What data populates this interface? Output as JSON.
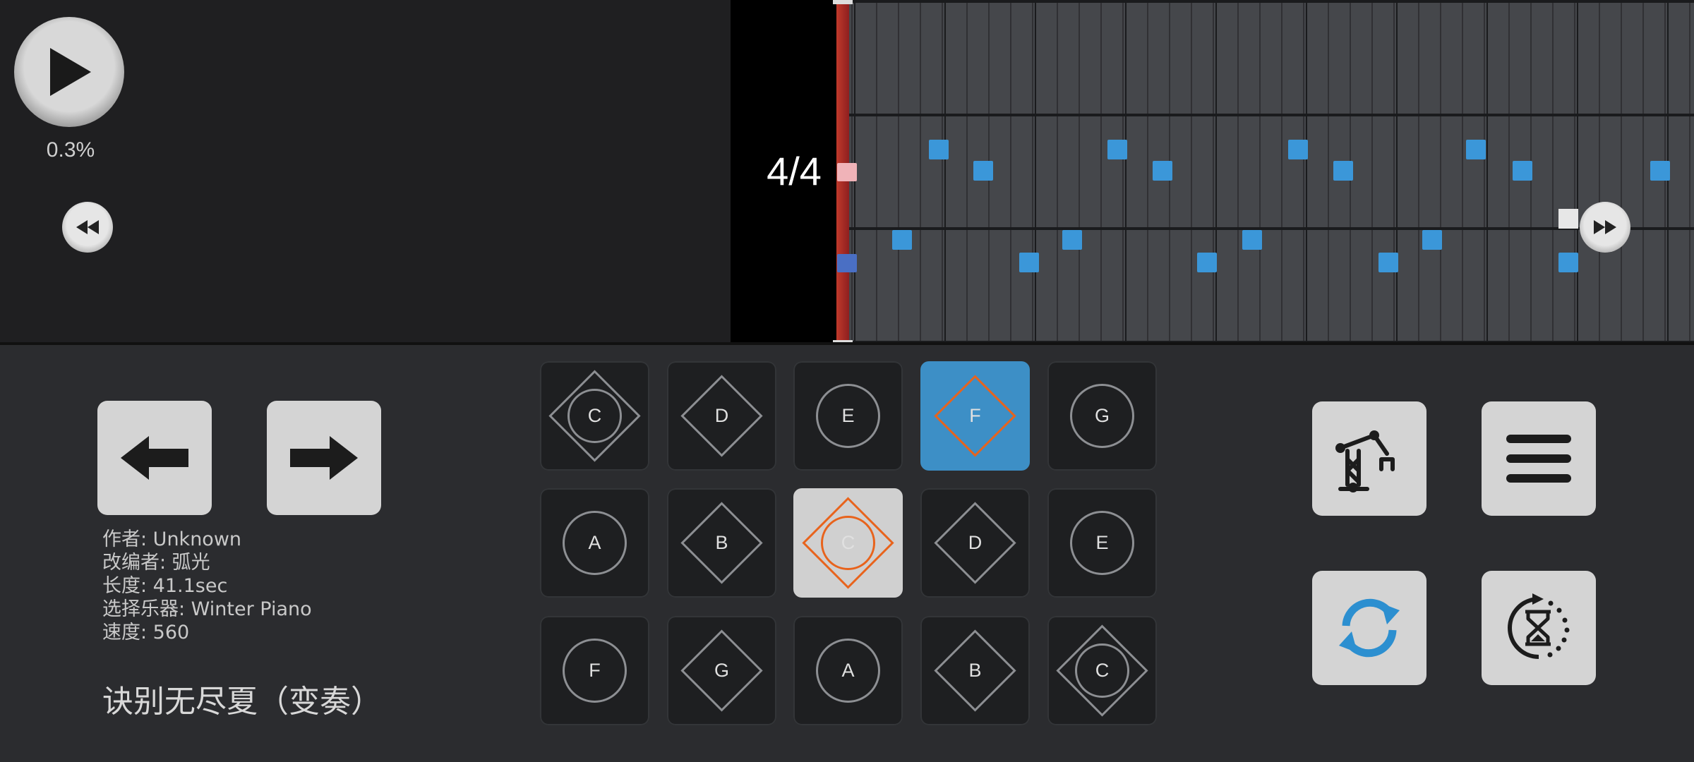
{
  "player": {
    "progress_text": "0.3%",
    "time_signature": "4/4"
  },
  "icons": {
    "play": "play-icon",
    "rewind": "rewind-icon",
    "fast_forward": "fast-forward-icon",
    "prev": "arrow-left-icon",
    "next": "arrow-right-icon",
    "robot": "robot-arm-icon",
    "menu": "hamburger-menu-icon",
    "sync": "sync-icon",
    "timer": "hourglass-timer-icon"
  },
  "colors": {
    "note": "#3b97d9",
    "active_key": "#3d8fc6",
    "highlight_shape": "#e8631c",
    "playhead": "#c0392b"
  },
  "song_info": {
    "author": "作者: Unknown",
    "arranger": "改编者: 弧光",
    "length": "长度: 41.1sec",
    "instrument": "选择乐器: Winter Piano",
    "speed": "速度: 560",
    "title": "诀别无尽夏（变奏）"
  },
  "keys": [
    {
      "label": "C",
      "shape": "circle-diamond",
      "state": "normal"
    },
    {
      "label": "D",
      "shape": "diamond",
      "state": "normal"
    },
    {
      "label": "E",
      "shape": "circle",
      "state": "normal"
    },
    {
      "label": "F",
      "shape": "diamond",
      "state": "active-blue"
    },
    {
      "label": "G",
      "shape": "circle",
      "state": "normal"
    },
    {
      "label": "A",
      "shape": "circle",
      "state": "normal"
    },
    {
      "label": "B",
      "shape": "diamond",
      "state": "normal"
    },
    {
      "label": "C",
      "shape": "circle-diamond",
      "state": "active-gray"
    },
    {
      "label": "D",
      "shape": "diamond",
      "state": "normal"
    },
    {
      "label": "E",
      "shape": "circle",
      "state": "normal"
    },
    {
      "label": "F",
      "shape": "circle",
      "state": "normal"
    },
    {
      "label": "G",
      "shape": "diamond",
      "state": "normal"
    },
    {
      "label": "A",
      "shape": "circle",
      "state": "normal"
    },
    {
      "label": "B",
      "shape": "diamond",
      "state": "normal"
    },
    {
      "label": "C",
      "shape": "circle-diamond",
      "state": "normal"
    }
  ]
}
